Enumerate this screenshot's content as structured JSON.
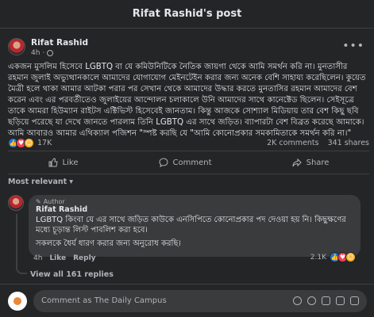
{
  "header": {
    "title": "Rifat Rashid's post"
  },
  "post": {
    "author": "Rifat Rashid",
    "time": "4h",
    "body": "একজন মুসলিম হিসেবে LGBTQ বা যে কমিউনিটিকে নৈতিক জায়গা থেকে আমি সমর্থন করি না। মুনতাসীর রহমান জুলাই অভ্যুত্থানকালে আমাদের যোগাযোগ মেইনটেইন করার জন্য অনেক বেশি সাহায্য করেছিলেন। কুয়েত মৈত্রী হলে থাকা আমার আটকা পরার পর সেখান থেকে আমাদের উদ্ধার করতে মুনতাসির রহমান আমাদের বেশ করেন এবং এর পরবর্তীতেও জুলাইয়ের আন্দোলন চলাকালে উনি আমাদের সাথে কানেক্টেড ছিলেন। সেইসূত্রে তাকে আমরা হিউম্যান রাইটস এক্টিভিস্ট হিসেবেই জানতাম। কিন্তু আজকে সোশ্যাল মিডিয়ায় তার বেশ কিছু ছবি ছড়িয়ে পরেছে যা দেখে জানতে পারলাম তিনি LGBTQ এর সাথে জড়িত। ব্যাপারটা বেশ বিব্রত করেছে আমাকে। আমি আবারও আমার এথিক্যাল পজিশন \"স্পষ্ট করছি যে \"আমি কোনোপ্রকার সমকামিতাকে সমর্থন করি না।\""
  },
  "stats": {
    "reactions_count": "17K",
    "comments": "2K comments",
    "shares": "341 shares"
  },
  "actions": {
    "like": "Like",
    "comment": "Comment",
    "share": "Share"
  },
  "filter": {
    "label": "Most relevant"
  },
  "comment": {
    "badge": "Author",
    "name": "Rifat Rashid",
    "text_1": "LGBTQ কিংবা যে এর সাথে জড়িত কাউকে এনসিপিতে কোনোপ্রকার পদ দেওয়া হয় নি। কিছুক্ষণের মধ্যে চূড়ান্ত লিস্ট পাবলিশ করা হবে।",
    "text_2": "সকলকে ধৈর্য ধারণ করার জন্য অনুরোধ করছি।",
    "time": "4h",
    "like": "Like",
    "reply": "Reply",
    "reactions_count": "2.1K"
  },
  "replies": {
    "label": "View all 161 replies"
  },
  "composer": {
    "placeholder": "Comment as The Daily Campus"
  }
}
